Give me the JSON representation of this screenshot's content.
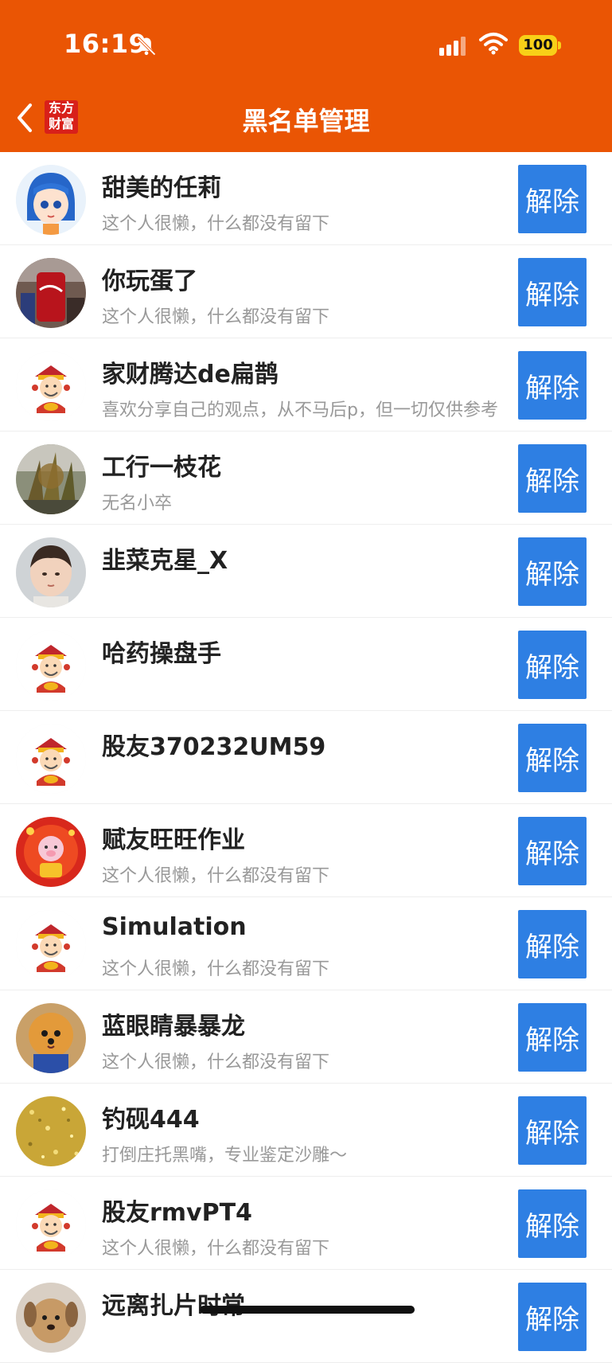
{
  "status_bar": {
    "time": "16:19",
    "battery": "100"
  },
  "header": {
    "logo_line1": "东方",
    "logo_line2": "财富",
    "title": "黑名单管理"
  },
  "colors": {
    "header": "#ea5504",
    "button": "#2e7fe3"
  },
  "unblock_label": "解除",
  "blocked_users": [
    {
      "name": "甜美的任莉",
      "desc": "这个人很懒，什么都没有留下",
      "avatar": "cartoon-girl"
    },
    {
      "name": "你玩蛋了",
      "desc": "这个人很懒，什么都没有留下",
      "avatar": "photo-can"
    },
    {
      "name": "家财腾达de扁鹊",
      "desc": "喜欢分享自己的观点，从不马后p，但一切仅供参考",
      "avatar": "caishen"
    },
    {
      "name": "工行一枝花",
      "desc": "无名小卒",
      "avatar": "photo-plant"
    },
    {
      "name": "韭菜克星_X",
      "desc": "",
      "avatar": "photo-child"
    },
    {
      "name": "哈药操盘手",
      "desc": "",
      "avatar": "caishen"
    },
    {
      "name": "股友370232UM59",
      "desc": "",
      "avatar": "caishen"
    },
    {
      "name": "赋友旺旺作业",
      "desc": "这个人很懒，什么都没有留下",
      "avatar": "newyear-red"
    },
    {
      "name": "Simulation",
      "desc": "这个人很懒，什么都没有留下",
      "avatar": "caishen"
    },
    {
      "name": "蓝眼睛暴暴龙",
      "desc": "这个人很懒，什么都没有留下",
      "avatar": "photo-dog"
    },
    {
      "name": "钓砚444",
      "desc": "打倒庄托黑嘴，专业鉴定沙雕～",
      "avatar": "gold-glitter"
    },
    {
      "name": "股友rmvPT4",
      "desc": "这个人很懒，什么都没有留下",
      "avatar": "caishen"
    },
    {
      "name": "远离扎片时常",
      "desc": "",
      "avatar": "photo-puppy"
    }
  ]
}
